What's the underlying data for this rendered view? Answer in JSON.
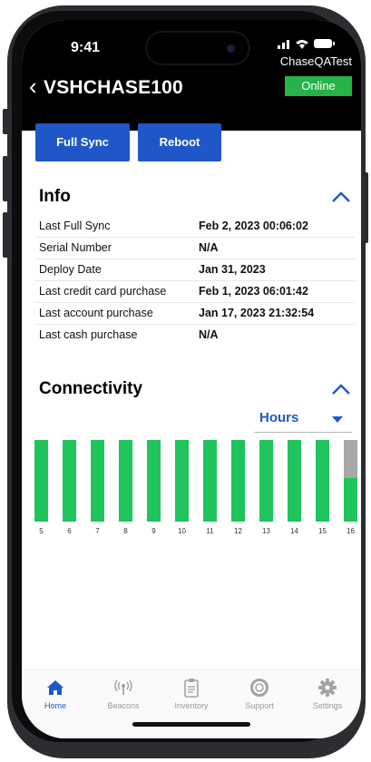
{
  "status_bar": {
    "time": "9:41",
    "signal": "∙∙❙ ◠ ▬",
    "carrier": "ChaseQATest"
  },
  "header": {
    "back_icon": "chevron-left-icon",
    "back_glyph": "‹",
    "title": "VSHCHASE100",
    "status": "Online",
    "status_color": "#25b34a"
  },
  "actions": {
    "full_sync_label": "Full Sync",
    "reboot_label": "Reboot",
    "button_color": "#1f57c8"
  },
  "info": {
    "title": "Info",
    "rows": [
      {
        "label": "Last Full Sync",
        "value": "Feb 2, 2023 00:06:02"
      },
      {
        "label": "Serial Number",
        "value": "N/A"
      },
      {
        "label": "Deploy Date",
        "value": "Jan 31, 2023"
      },
      {
        "label": "Last credit card purchase",
        "value": "Feb 1, 2023 06:01:42"
      },
      {
        "label": "Last account purchase",
        "value": "Jan 17, 2023 21:32:54"
      },
      {
        "label": "Last cash purchase",
        "value": "N/A"
      }
    ]
  },
  "connectivity": {
    "title": "Connectivity",
    "range_select": {
      "value": "Hours",
      "icon": "caret-down-icon"
    },
    "online_color": "#1fc45d",
    "offline_color": "#a8a8a8"
  },
  "chart_data": {
    "type": "bar",
    "categories": [
      "5",
      "6",
      "7",
      "8",
      "9",
      "10",
      "11",
      "12",
      "13",
      "14",
      "15",
      "16"
    ],
    "values": [
      1,
      1,
      1,
      1,
      1,
      1,
      1,
      1,
      1,
      1,
      1,
      0.53
    ],
    "ylim": [
      0,
      1
    ],
    "grid": false,
    "legend": "none"
  },
  "tabbar": {
    "tabs": [
      {
        "label": "Home",
        "icon": "home-icon",
        "active": true
      },
      {
        "label": "Beacons",
        "icon": "beacon-icon",
        "active": false
      },
      {
        "label": "Inventory",
        "icon": "clipboard-icon",
        "active": false
      },
      {
        "label": "Support",
        "icon": "lifebuoy-icon",
        "active": false
      },
      {
        "label": "Settings",
        "icon": "gear-icon",
        "active": false
      }
    ]
  }
}
